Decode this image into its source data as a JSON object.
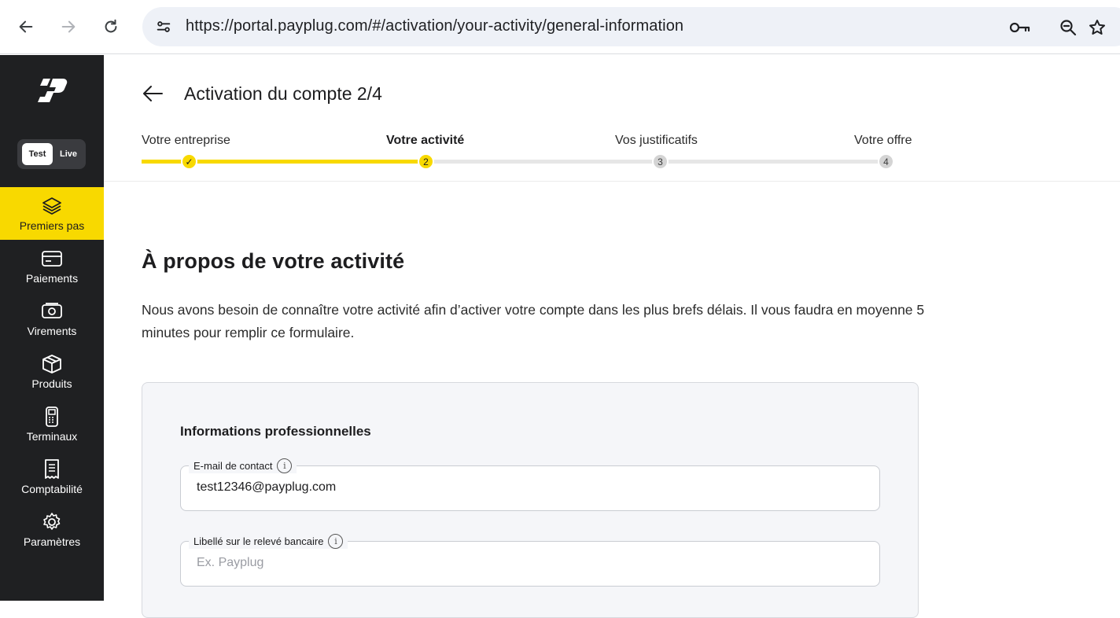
{
  "browser": {
    "url": "https://portal.payplug.com/#/activation/your-activity/general-information"
  },
  "sidebar": {
    "env_toggle": {
      "test_label": "Test",
      "live_label": "Live"
    },
    "items": [
      {
        "label": "Premiers pas",
        "icon": "layers-icon",
        "active": true
      },
      {
        "label": "Paiements",
        "icon": "card-icon",
        "active": false
      },
      {
        "label": "Virements",
        "icon": "banknote-icon",
        "active": false
      },
      {
        "label": "Produits",
        "icon": "box-icon",
        "active": false
      },
      {
        "label": "Terminaux",
        "icon": "terminal-icon",
        "active": false
      },
      {
        "label": "Comptabilité",
        "icon": "receipt-icon",
        "active": false
      },
      {
        "label": "Paramètres",
        "icon": "gear-icon",
        "active": false
      }
    ]
  },
  "header": {
    "title": "Activation du compte 2/4",
    "steps": [
      {
        "label": "Votre entreprise",
        "marker": "✓",
        "status": "done"
      },
      {
        "label": "Votre activité",
        "marker": "2",
        "status": "current"
      },
      {
        "label": "Vos justificatifs",
        "marker": "3",
        "status": "todo"
      },
      {
        "label": "Votre offre",
        "marker": "4",
        "status": "todo"
      }
    ]
  },
  "main": {
    "section_title": "À propos de votre activité",
    "description": "Nous avons besoin de connaître votre activité afin d’activer votre compte dans les plus brefs délais. Il vous faudra en moyenne 5 minutes pour remplir ce formulaire.",
    "card": {
      "title": "Informations professionnelles",
      "fields": [
        {
          "label": "E-mail de contact",
          "value": "test12346@payplug.com",
          "placeholder": ""
        },
        {
          "label": "Libellé sur le relevé bancaire",
          "value": "",
          "placeholder": "Ex. Payplug"
        }
      ]
    }
  },
  "colors": {
    "accent": "#f8d900",
    "sidebar_bg": "#1f2022",
    "card_bg": "#f5f6f9"
  }
}
